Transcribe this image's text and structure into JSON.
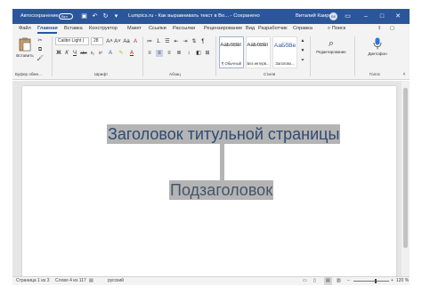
{
  "titlebar": {
    "autosave_label": "Автосохранение",
    "autosave_state": "Вкл",
    "title": "Lumpics.ru - Как выравнивать текст в Во... - Сохранено",
    "user": "Виталий Каиров",
    "avatar": "ВК",
    "icons": [
      "save-icon",
      "undo-icon",
      "redo-icon",
      "customize-quick-access-icon"
    ],
    "controls": {
      "minimize": "–",
      "maximize": "□",
      "close": "✕"
    }
  },
  "tabs": [
    "Файл",
    "Главная",
    "Вставка",
    "Конструктор",
    "Макет",
    "Ссылки",
    "Рассылки",
    "Рецензирование",
    "Вид",
    "Разработчик",
    "Справка",
    "Поиск"
  ],
  "ribbon": {
    "clipboard": {
      "label": "Буфер обме...",
      "paste": "Вставить"
    },
    "font": {
      "label": "Шрифт",
      "name": "Calibri Light (",
      "size": "28",
      "bold": "Ж",
      "italic": "К",
      "underline": "Ч",
      "strike": "abc",
      "sub": "x₂",
      "sup": "x²",
      "clear": "A",
      "case": "Aa",
      "grow": "A˄",
      "shrink": "A˅"
    },
    "paragraph": {
      "label": "Абзац"
    },
    "styles": {
      "label": "Стили",
      "items": [
        {
          "sample": "АаБбВвГ",
          "name": "¶ Обычный"
        },
        {
          "sample": "АаБбВвГ",
          "name": "Без интерв..."
        },
        {
          "sample": "АаБбВе",
          "name": "Заголово..."
        }
      ]
    },
    "editing": {
      "label": "Редактирование"
    },
    "voice": {
      "label": "Голос",
      "dictation": "Диктофон"
    }
  },
  "document": {
    "title": "Заголовок титульной страницы",
    "subtitle": "Подзаголовок"
  },
  "statusbar": {
    "page": "Страница 1 из 3",
    "words": "Слово 4 из 117",
    "language": "русский",
    "zoom": "120 %",
    "zoom_level": 0.6
  },
  "colors": {
    "accent": "#2b579a",
    "highlight": "#b4b4b4",
    "title_text": "#2f4a72",
    "subtitle_text": "#44546a"
  }
}
